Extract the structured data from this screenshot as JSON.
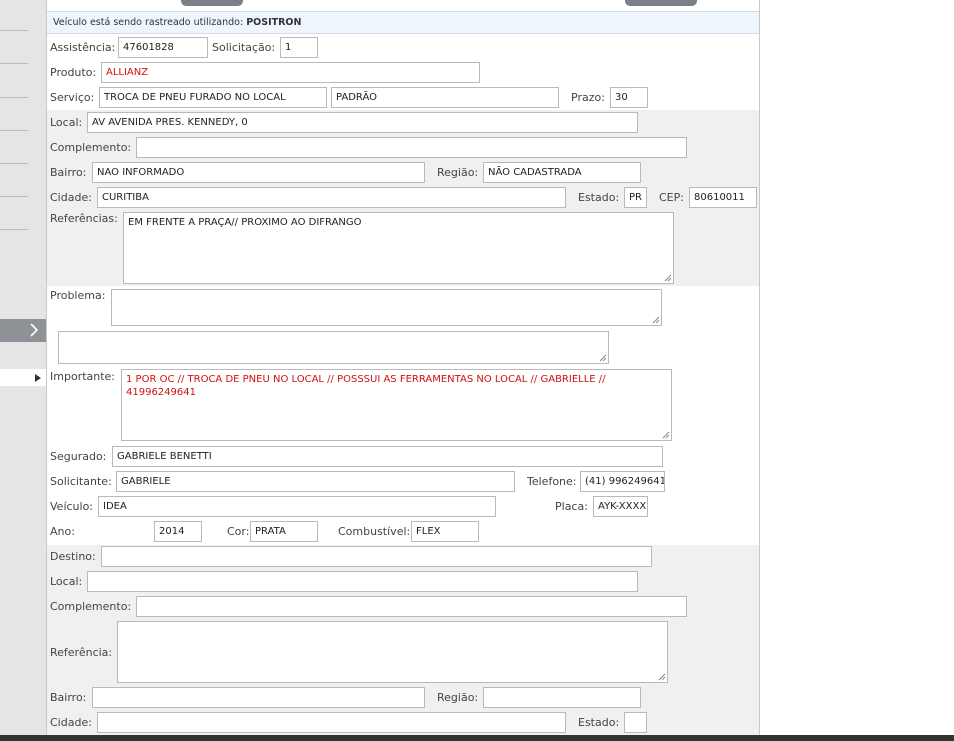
{
  "banner": {
    "text": "Veículo está sendo rastreado utilizando:",
    "provider": "POSITRON"
  },
  "form": {
    "assistencia": {
      "label": "Assistência:",
      "value": "47601828"
    },
    "solicitacao": {
      "label": "Solicitação:",
      "value": "1"
    },
    "produto": {
      "label": "Produto:",
      "value": "ALLIANZ"
    },
    "servico": {
      "label": "Serviço:",
      "value": "TROCA DE PNEU FURADO NO LOCAL",
      "tipo": "PADRÃO"
    },
    "prazo": {
      "label": "Prazo:",
      "value": "30"
    },
    "local": {
      "label": "Local:",
      "value": "AV AVENIDA PRES. KENNEDY, 0"
    },
    "complemento": {
      "label": "Complemento:",
      "value": ""
    },
    "bairro": {
      "label": "Bairro:",
      "value": "NAO INFORMADO"
    },
    "regiao": {
      "label": "Região:",
      "value": "NÃO CADASTRADA"
    },
    "cidade": {
      "label": "Cidade:",
      "value": "CURITIBA"
    },
    "estado": {
      "label": "Estado:",
      "value": "PR"
    },
    "cep": {
      "label": "CEP:",
      "value": "80610011"
    },
    "referencias": {
      "label": "Referências:",
      "value": "EM FRENTE A PRAÇA// PROXIMO AO DIFRANGO"
    },
    "problema": {
      "label": "Problema:",
      "value": ""
    },
    "extra": {
      "value": ""
    },
    "importante": {
      "label": "Importante:",
      "value": "1 POR OC  // TROCA DE PNEU NO LOCAL  // POSSSUI AS FERRAMENTAS NO LOCAL  // GABRIELLE  // 41996249641"
    },
    "segurado": {
      "label": "Segurado:",
      "value": "GABRIELE BENETTI"
    },
    "solicitante": {
      "label": "Solicitante:",
      "value": "GABRIELE"
    },
    "telefone": {
      "label": "Telefone:",
      "value": "(41) 996249641"
    },
    "veiculo": {
      "label": "Veículo:",
      "value": "IDEA"
    },
    "placa": {
      "label": "Placa:",
      "value": "AYK-XXXX"
    },
    "ano": {
      "label": "Ano:",
      "value": "2014"
    },
    "cor": {
      "label": "Cor:",
      "value": "PRATA"
    },
    "combustivel": {
      "label": "Combustível:",
      "value": "FLEX"
    }
  },
  "destino": {
    "destino": {
      "label": "Destino:",
      "value": ""
    },
    "local": {
      "label": "Local:",
      "value": ""
    },
    "complemento": {
      "label": "Complemento:",
      "value": ""
    },
    "referencia": {
      "label": "Referência:",
      "value": ""
    },
    "bairro": {
      "label": "Bairro:",
      "value": ""
    },
    "regiao": {
      "label": "Região:",
      "value": ""
    },
    "cidade": {
      "label": "Cidade:",
      "value": ""
    },
    "estado": {
      "label": "Estado:",
      "value": ""
    }
  },
  "colors": {
    "sidebar": "#e5e5e5",
    "banner": "#eef5fc",
    "band": "#f0f0f0",
    "important_text": "#d01010"
  },
  "icons": {
    "expand": "chevron-right-icon",
    "selected": "caret-right-icon"
  }
}
